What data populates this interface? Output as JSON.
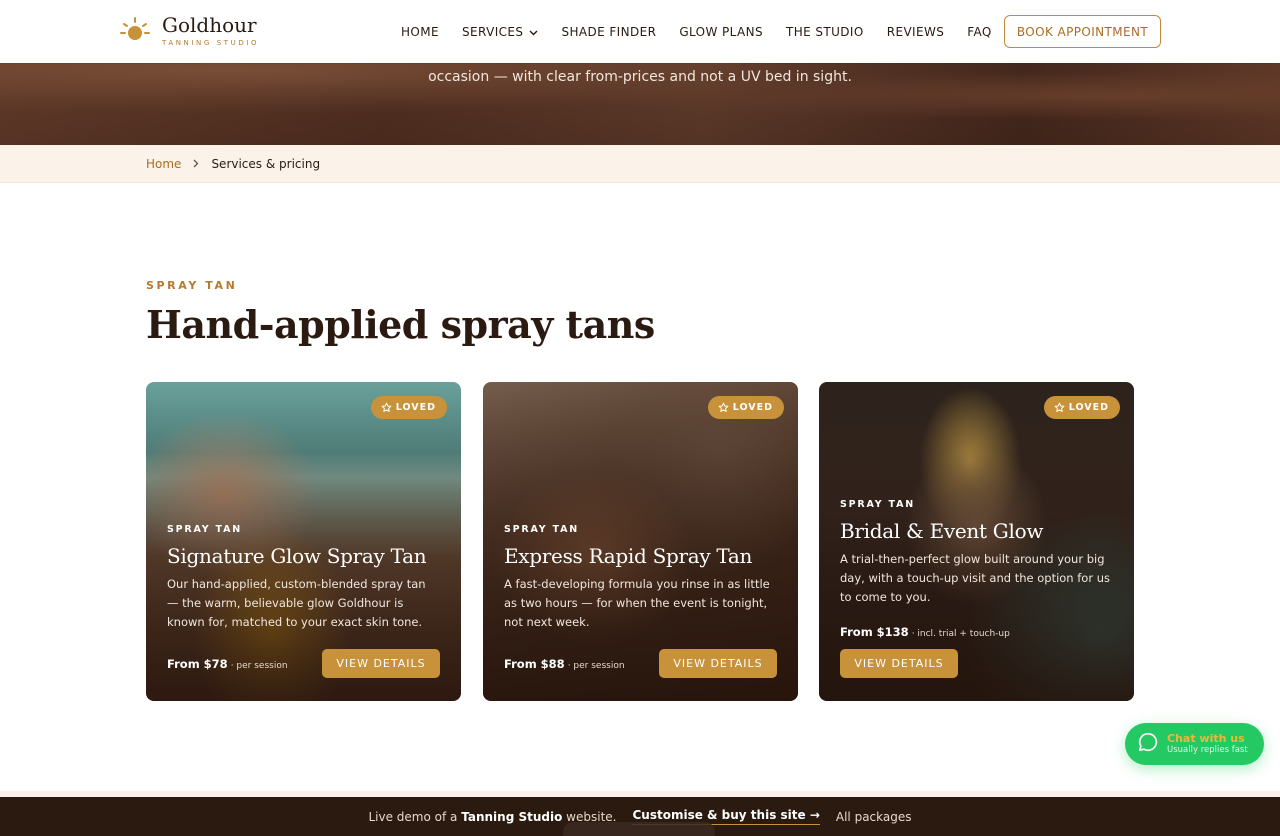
{
  "brand": {
    "name": "Goldhour",
    "tagline": "TANNING STUDIO",
    "logo_icon": "sun-icon",
    "accent_color": "#c8923a"
  },
  "nav": {
    "items": [
      "HOME",
      "SERVICES",
      "SHADE FINDER",
      "GLOW PLANS",
      "THE STUDIO",
      "REVIEWS",
      "FAQ"
    ],
    "cta": "BOOK APPOINTMENT"
  },
  "hero": {
    "text": "occasion — with clear from-prices and not a UV bed in sight."
  },
  "breadcrumb": {
    "home": "Home",
    "current": "Services & pricing"
  },
  "section": {
    "eyebrow": "SPRAY TAN",
    "title": "Hand-applied spray tans"
  },
  "cards": [
    {
      "badge": "LOVED",
      "eyebrow": "SPRAY TAN",
      "title": "Signature Glow Spray Tan",
      "description": "Our hand-applied, custom-blended spray tan — the warm, believable glow Goldhour is known for, matched to your exact skin tone.",
      "price": "From $78",
      "price_note": "· per session",
      "button": "VIEW DETAILS"
    },
    {
      "badge": "LOVED",
      "eyebrow": "SPRAY TAN",
      "title": "Express Rapid Spray Tan",
      "description": "A fast-developing formula you rinse in as little as two hours — for when the event is tonight, not next week.",
      "price": "From $88",
      "price_note": "· per session",
      "button": "VIEW DETAILS"
    },
    {
      "badge": "LOVED",
      "eyebrow": "SPRAY TAN",
      "title": "Bridal & Event Glow",
      "description": "A trial-then-perfect glow built around your big day, with a touch-up visit and the option for us to come to you.",
      "price": "From $138",
      "price_note": "· incl. trial + touch-up",
      "button": "VIEW DETAILS"
    }
  ],
  "chat": {
    "title": "Chat with us",
    "subtitle": "Usually replies fast",
    "icon": "chat-bubble-icon"
  },
  "bottom_bar": {
    "prefix": "Live demo of a",
    "bold": "Tanning Studio",
    "suffix": "website.",
    "cta": "Customise & buy this site →",
    "link": "All packages"
  }
}
